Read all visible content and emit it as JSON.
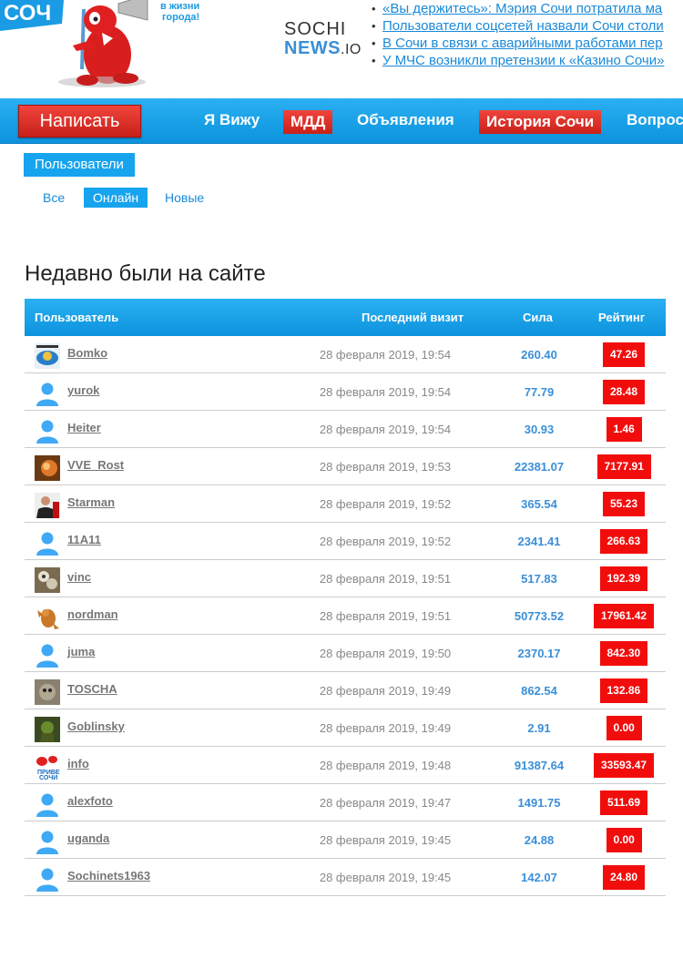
{
  "colors": {
    "accent": "#17a4ee",
    "nav": "#0d93dd",
    "red": "#f20d0d",
    "link": "#1a8ad8"
  },
  "logo": {
    "icon": "sochi-mascot-logo",
    "text": "СОЧИ",
    "tagline": "в жизни города!"
  },
  "sochinews": {
    "line1": "SOCHI",
    "line2": "NEWS",
    "line2_suffix": ".IO"
  },
  "news": [
    "«Вы держитесь»: Мэрия Сочи потратила ма",
    "Пользователи соцсетей назвали Сочи столи",
    "В Сочи в связи с аварийными работами пер",
    "У МЧС возникли претензии к «Казино Сочи»"
  ],
  "nav": {
    "write": "Написать",
    "items": [
      "Я Вижу",
      "МДД",
      "Объявления",
      "История Сочи",
      "Вопрос"
    ]
  },
  "users_tab": "Пользователи",
  "subtabs": [
    "Все",
    "Онлайн",
    "Новые"
  ],
  "heading": "Недавно были на сайте",
  "table": {
    "headers": [
      "Пользователь",
      "Последний визит",
      "Сила",
      "Рейтинг"
    ],
    "rows": [
      {
        "avatar": "bomko-avatar",
        "name": "Bomko",
        "date": "28 февраля 2019, 19:54",
        "power": "260.40",
        "rating": "47.26"
      },
      {
        "avatar": "default-user-icon",
        "name": "yurok",
        "date": "28 февраля 2019, 19:54",
        "power": "77.79",
        "rating": "28.48"
      },
      {
        "avatar": "default-user-icon",
        "name": "Heiter",
        "date": "28 февраля 2019, 19:54",
        "power": "30.93",
        "rating": "1.46"
      },
      {
        "avatar": "vve-avatar",
        "name": "VVE_Rost",
        "date": "28 февраля 2019, 19:53",
        "power": "22381.07",
        "rating": "7177.91"
      },
      {
        "avatar": "starman-avatar",
        "name": "Starman",
        "date": "28 февраля 2019, 19:52",
        "power": "365.54",
        "rating": "55.23"
      },
      {
        "avatar": "default-user-icon",
        "name": "11A11",
        "date": "28 февраля 2019, 19:52",
        "power": "2341.41",
        "rating": "266.63"
      },
      {
        "avatar": "vinc-avatar",
        "name": "vinc",
        "date": "28 февраля 2019, 19:51",
        "power": "517.83",
        "rating": "192.39"
      },
      {
        "avatar": "nordman-avatar",
        "name": "nordman",
        "date": "28 февраля 2019, 19:51",
        "power": "50773.52",
        "rating": "17961.42"
      },
      {
        "avatar": "default-user-icon",
        "name": "juma",
        "date": "28 февраля 2019, 19:50",
        "power": "2370.17",
        "rating": "842.30"
      },
      {
        "avatar": "toscha-avatar",
        "name": "TOSCHA",
        "date": "28 февраля 2019, 19:49",
        "power": "862.54",
        "rating": "132.86"
      },
      {
        "avatar": "goblinsky-avatar",
        "name": "Goblinsky",
        "date": "28 февраля 2019, 19:49",
        "power": "2.91",
        "rating": "0.00"
      },
      {
        "avatar": "info-avatar",
        "name": "info",
        "date": "28 февраля 2019, 19:48",
        "power": "91387.64",
        "rating": "33593.47"
      },
      {
        "avatar": "default-user-icon",
        "name": "alexfoto",
        "date": "28 февраля 2019, 19:47",
        "power": "1491.75",
        "rating": "511.69"
      },
      {
        "avatar": "default-user-icon",
        "name": "uganda",
        "date": "28 февраля 2019, 19:45",
        "power": "24.88",
        "rating": "0.00"
      },
      {
        "avatar": "default-user-icon",
        "name": "Sochinets1963",
        "date": "28 февраля 2019, 19:45",
        "power": "142.07",
        "rating": "24.80"
      }
    ]
  }
}
